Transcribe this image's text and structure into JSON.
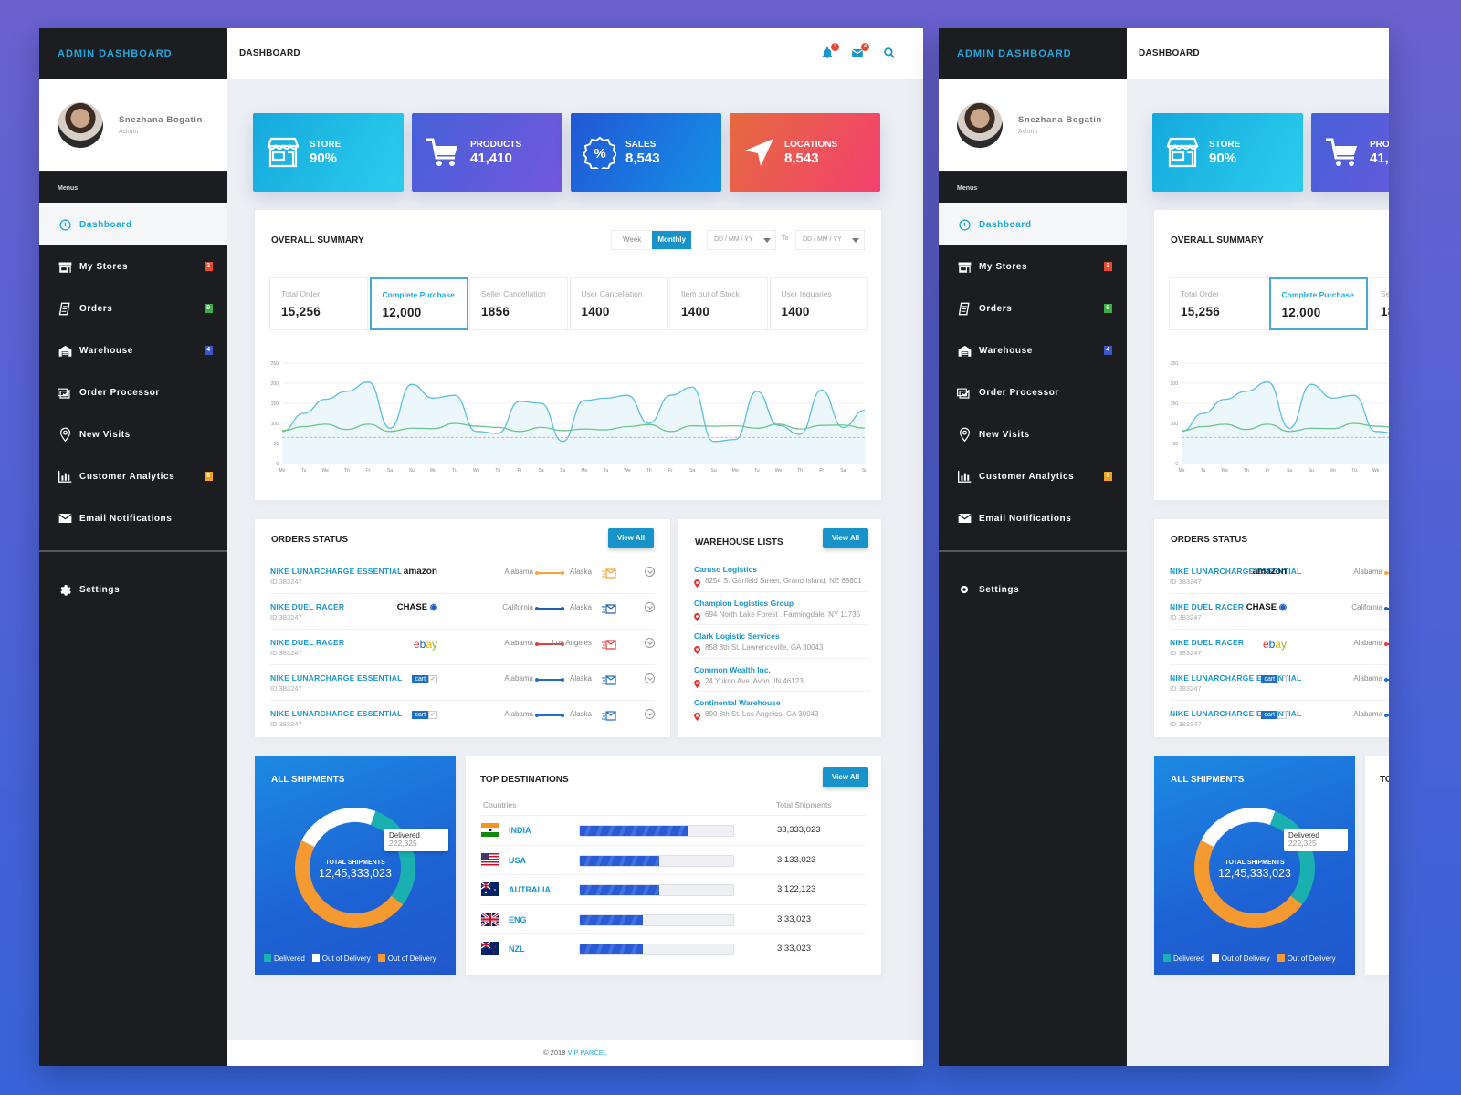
{
  "brand": "ADMIN DASHBOARD",
  "page_title": "DASHBOARD",
  "user": {
    "name": "Snezhana Bogatin",
    "role": "Admin"
  },
  "menus_label": "Menus",
  "nav": [
    {
      "label": "Dashboard",
      "icon": "dashboard-icon",
      "active": true
    },
    {
      "label": "My Stores",
      "icon": "store-icon",
      "badge": "3",
      "badge_color": "#e8482f"
    },
    {
      "label": "Orders",
      "icon": "receipt-icon",
      "badge": "9",
      "badge_color": "#3fae49"
    },
    {
      "label": "Warehouse",
      "icon": "warehouse-icon",
      "badge": "4",
      "badge_color": "#3c56c9"
    },
    {
      "label": "Order Processor",
      "icon": "order-processor-icon"
    },
    {
      "label": "New Visits",
      "icon": "location-pin-icon"
    },
    {
      "label": "Customer Analytics",
      "icon": "analytics-icon",
      "badge": "8",
      "badge_color": "#f4a01c"
    },
    {
      "label": "Email Notifications",
      "icon": "mail-icon"
    }
  ],
  "settings_label": "Settings",
  "topbar": {
    "notifications_count": "3",
    "messages_count": "4"
  },
  "stats": [
    {
      "label": "STORE",
      "value": "90%"
    },
    {
      "label": "PRODUCTS",
      "value": "41,410"
    },
    {
      "label": "SALES",
      "value": "8,543"
    },
    {
      "label": "LOCATIONS",
      "value": "8,543"
    }
  ],
  "summary": {
    "title": "OVERALL SUMMARY",
    "toggle": [
      "Week",
      "Monthly"
    ],
    "toggle_selected": "Monthly",
    "date_from_placeholder": "DD / MM / YY",
    "date_to_label": "To",
    "date_to_placeholder": "DD / MM / YY",
    "metrics": [
      {
        "label": "Total Order",
        "value": "15,256"
      },
      {
        "label": "Complete Purchase",
        "value": "12,000",
        "selected": true
      },
      {
        "label": "Seller Cancellation",
        "value": "1856"
      },
      {
        "label": "User Cancellation",
        "value": "1400"
      },
      {
        "label": "Item out of Stock",
        "value": "1400"
      },
      {
        "label": "User Inquaries",
        "value": "1400"
      }
    ]
  },
  "chart_data": {
    "type": "line",
    "title": "",
    "xlabel": "",
    "ylabel": "",
    "ylim": [
      0,
      250
    ],
    "yticks": [
      0,
      50,
      100,
      150,
      200,
      250
    ],
    "grid": true,
    "x": [
      "Mo",
      "Tu",
      "We",
      "Th",
      "Fr",
      "Sa",
      "Su",
      "Mo",
      "Tu",
      "We",
      "Th",
      "Fr",
      "Sa",
      "Su",
      "Mo",
      "Tu",
      "We",
      "Th",
      "Fr",
      "Sa",
      "Su",
      "Mo",
      "Tu",
      "We",
      "Th",
      "Fr",
      "Sa",
      "Su"
    ],
    "series": [
      {
        "name": "primary",
        "color": "#5bbfe0",
        "fill": true,
        "values": [
          80,
          125,
          160,
          180,
          203,
          88,
          197,
          163,
          170,
          80,
          75,
          155,
          150,
          55,
          157,
          163,
          170,
          100,
          170,
          190,
          55,
          60,
          180,
          95,
          73,
          183,
          90,
          133
        ]
      },
      {
        "name": "secondary",
        "color": "#6cc58a",
        "values": [
          82,
          92,
          98,
          85,
          98,
          80,
          88,
          87,
          100,
          93,
          90,
          80,
          90,
          82,
          86,
          84,
          92,
          97,
          80,
          94,
          93,
          94,
          88,
          98,
          86,
          95,
          96,
          88
        ]
      },
      {
        "name": "threshold",
        "color": "#f2a3a3",
        "dashed": true,
        "values": [
          65,
          65,
          65,
          65,
          65,
          65,
          65,
          65,
          65,
          65,
          65,
          65,
          65,
          65,
          65,
          65,
          65,
          65,
          65,
          65,
          65,
          65,
          65,
          65,
          65,
          65,
          65,
          65
        ]
      }
    ]
  },
  "orders_status": {
    "title": "ORDERS STATUS",
    "view_all": "View All",
    "rows": [
      {
        "product": "NIKE LUNARCHARGE ESSENTIAL",
        "id": "ID 383247",
        "carrier": "amazon",
        "from": "Alabama",
        "to": "Alaska",
        "color": "#f7a23b"
      },
      {
        "product": "NIKE DUEL RACER",
        "id": "ID 383247",
        "carrier": "CHASE",
        "from": "California",
        "to": "Alaska",
        "color": "#1f5fb6"
      },
      {
        "product": "NIKE DUEL RACER",
        "id": "ID 383247",
        "carrier": "ebay",
        "from": "Alabama",
        "to": "Los Angeles",
        "color": "#e43b3b"
      },
      {
        "product": "NIKE LUNARCHARGE ESSENTIAL",
        "id": "ID 383247",
        "carrier": "cart",
        "from": "Alabama",
        "to": "Alaska",
        "color": "#1f6fc6"
      },
      {
        "product": "NIKE LUNARCHARGE ESSENTIAL",
        "id": "ID 383247",
        "carrier": "cart",
        "from": "Alabama",
        "to": "Alaska",
        "color": "#1f6fc6"
      }
    ]
  },
  "warehouse": {
    "title": "WAREHOUSE LISTS",
    "view_all": "View All",
    "rows": [
      {
        "name": "Caruso Logistics",
        "address": "8254 S. Garfield Street. Grand Island, NE 68801"
      },
      {
        "name": "Champion Logistics Group",
        "address": "694 North Lake Forest . Farmingdale, NY 11735"
      },
      {
        "name": "Clark Logistic Services",
        "address": "858 8th St. Lawrenceville, GA 30043"
      },
      {
        "name": "Common Wealth Inc.",
        "address": "24 Yukon Ave. Avon, IN 46123"
      },
      {
        "name": "Continental Warehouse",
        "address": "890 8th St. Los Angeles, GA 30043"
      }
    ]
  },
  "shipments": {
    "title": "ALL SHIPMENTS",
    "center_label": "TOTAL SHIPMENTS",
    "center_value": "12,45,333,023",
    "tooltip_label": "Delivered",
    "tooltip_value": "222,325",
    "segments": [
      {
        "name": "Delivered",
        "color": "#1ab0b0",
        "share": 0.3
      },
      {
        "name": "Out of Delivery",
        "color": "#f49a30",
        "share": 0.47
      },
      {
        "name": "Out of Delivery",
        "color": "#ffffff",
        "share": 0.23
      }
    ],
    "legend": [
      {
        "label": "Delivered",
        "color": "#1ab0b0"
      },
      {
        "label": "Out of Delivery",
        "color": "#ffffff"
      },
      {
        "label": "Out of Delivery",
        "color": "#f49a30"
      }
    ]
  },
  "destinations": {
    "title": "TOP DESTINATIONS",
    "view_all": "View All",
    "col_countries": "Countries",
    "col_total": "Total Shipments",
    "rows": [
      {
        "country": "INDIA",
        "flag": "india-flag-icon",
        "progress": 0.71,
        "total": "33,333,023"
      },
      {
        "country": "USA",
        "flag": "usa-flag-icon",
        "progress": 0.52,
        "total": "3,133,023"
      },
      {
        "country": "AUTRALIA",
        "flag": "australia-flag-icon",
        "progress": 0.52,
        "total": "3,122,123"
      },
      {
        "country": "ENG",
        "flag": "uk-flag-icon",
        "progress": 0.41,
        "total": "3,33,023"
      },
      {
        "country": "NZL",
        "flag": "nz-flag-icon",
        "progress": 0.41,
        "total": "3,33,023"
      }
    ]
  },
  "footer": {
    "copyright": "© 2018",
    "brand": "VIP PARCEL"
  }
}
